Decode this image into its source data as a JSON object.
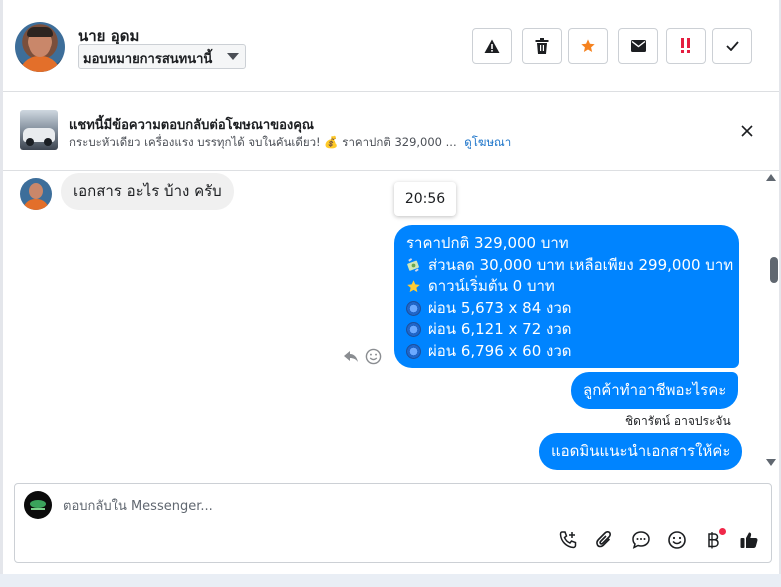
{
  "header": {
    "contact_name": "นาย อุดม",
    "assign_value": "มอบหมายการสนทนานี้",
    "actions": [
      {
        "name": "report-spam-button",
        "icon": "warning-icon"
      },
      {
        "name": "delete-button",
        "icon": "trash-icon"
      },
      {
        "name": "star-button",
        "icon": "star-icon",
        "color": "#f5821f"
      },
      {
        "name": "mark-unread-button",
        "icon": "envelope-icon"
      },
      {
        "name": "follow-up-button",
        "icon": "double-exclamation-icon",
        "color": "#e41e3f"
      },
      {
        "name": "mark-done-button",
        "icon": "checkmark-icon"
      }
    ]
  },
  "ad_banner": {
    "title": "แชทนี้มีข้อความตอบกลับต่อโฆษณาของคุณ",
    "description": "กระบะหัวเดียว เครื่องแรง บรรทุกได้ จบในคันเดียว! 💰 ราคาปกติ 329,000 ...",
    "link": "ดูโฆษณา"
  },
  "conversation": {
    "incoming_message": "เอกสาร อะไร บ้าง ครับ",
    "timestamp": "20:56",
    "outgoing_big": {
      "lines": [
        {
          "emoji": "",
          "text": "ราคาปกติ 329,000 บาท"
        },
        {
          "emoji": "money-with-wings-icon",
          "text": "ส่วนลด 30,000 บาท เหลือเพียง 299,000 บาท"
        },
        {
          "emoji": "star-icon",
          "text": "ดาวน์เริ่มต้น 0 บาท"
        },
        {
          "emoji": "blue-circle-icon",
          "text": "ผ่อน 5,673 x 84 งวด"
        },
        {
          "emoji": "blue-circle-icon",
          "text": "ผ่อน 6,121 x 72 งวด"
        },
        {
          "emoji": "blue-circle-icon",
          "text": "ผ่อน 6,796 x 60 งวด"
        }
      ]
    },
    "outgoing_1": "ลูกค้าทำอาชีพอะไรคะ",
    "sender_name": "ชิดารัตน์ อาจประจัน",
    "outgoing_2": "แอดมินแนะนำเอกสารให้ค่ะ"
  },
  "composer": {
    "placeholder": "ตอบกลับใน Messenger..."
  },
  "colors": {
    "outgoing_bubble": "#0084ff",
    "incoming_bubble": "#f0f0f0",
    "link": "#1a73c9"
  }
}
